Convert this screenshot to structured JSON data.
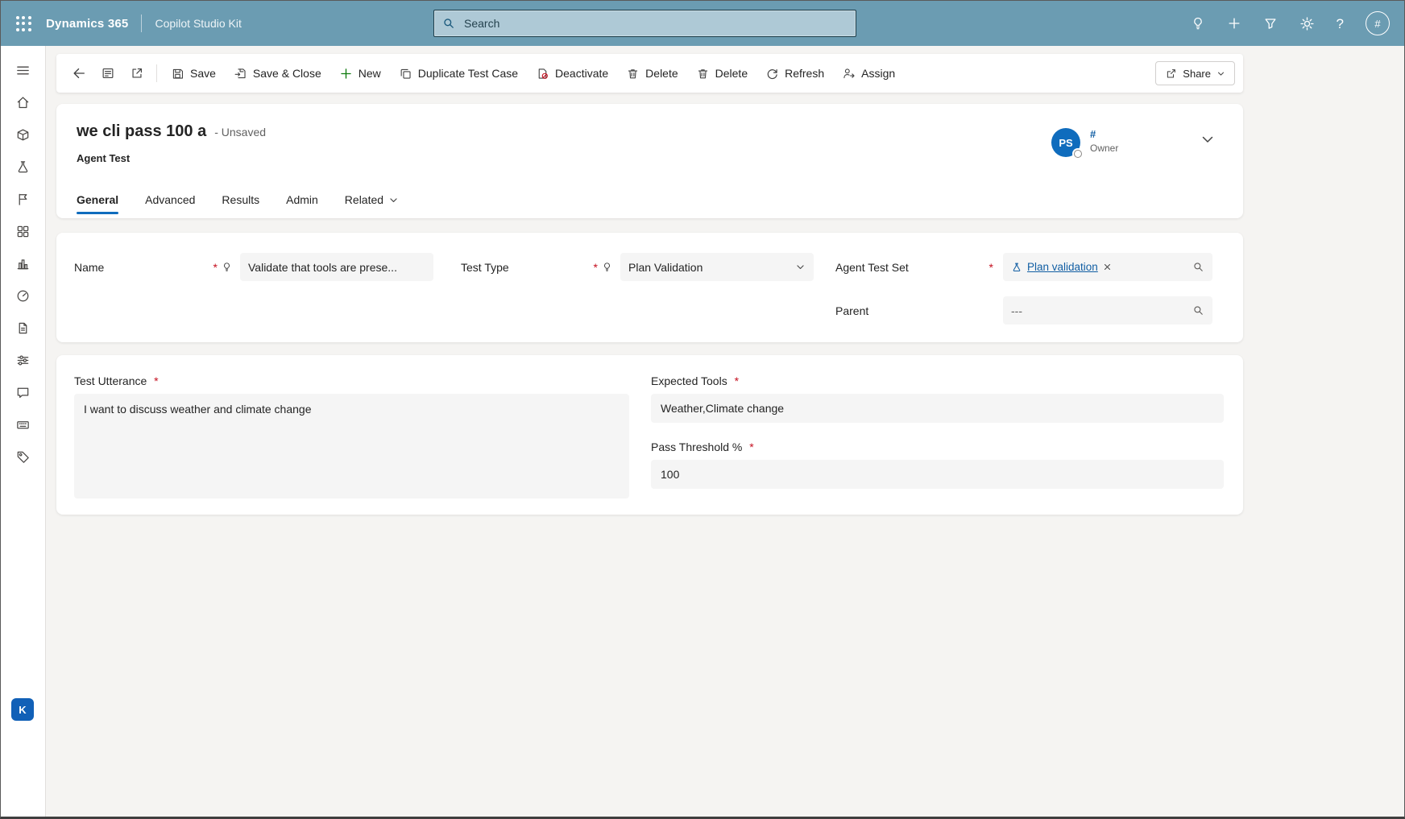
{
  "topbar": {
    "brand": "Dynamics 365",
    "app": "Copilot Studio Kit",
    "search_placeholder": "Search",
    "account_initial": "#",
    "icons": [
      "app-launcher",
      "lightbulb",
      "add",
      "filter",
      "settings-gear",
      "help",
      "account-avatar"
    ]
  },
  "command_bar": {
    "icons": [
      "back-arrow",
      "form-switcher",
      "popout",
      "save",
      "save-and-close",
      "plus",
      "duplicate",
      "deactivate",
      "trash",
      "trash",
      "refresh",
      "assign",
      "share"
    ],
    "items": [
      {
        "label": "Save"
      },
      {
        "label": "Save & Close"
      },
      {
        "label": "New"
      },
      {
        "label": "Duplicate Test Case"
      },
      {
        "label": "Deactivate"
      },
      {
        "label": "Delete"
      },
      {
        "label": "Delete"
      },
      {
        "label": "Refresh"
      },
      {
        "label": "Assign"
      }
    ],
    "share": "Share"
  },
  "record": {
    "title": "we cli pass 100 a",
    "status": "- Unsaved",
    "entity": "Agent Test",
    "owner": {
      "initials": "PS",
      "name": "#",
      "role": "Owner"
    },
    "tabs": [
      {
        "label": "General",
        "active": true
      },
      {
        "label": "Advanced"
      },
      {
        "label": "Results"
      },
      {
        "label": "Admin"
      },
      {
        "label": "Related",
        "has_menu": true
      }
    ]
  },
  "form": {
    "name": {
      "label": "Name",
      "required": true,
      "value": "Validate that tools are prese..."
    },
    "test_type": {
      "label": "Test Type",
      "required": true,
      "value": "Plan Validation"
    },
    "agent_test_set": {
      "label": "Agent Test Set",
      "required": true,
      "value": "Plan validation"
    },
    "parent": {
      "label": "Parent",
      "value": "---"
    },
    "test_utterance": {
      "label": "Test Utterance",
      "required": true,
      "value": "I want to discuss weather and climate change"
    },
    "expected_tools": {
      "label": "Expected Tools",
      "required": true,
      "value": "Weather,Climate change"
    },
    "pass_threshold": {
      "label": "Pass Threshold %",
      "required": true,
      "value": "100"
    }
  },
  "sidebar": {
    "user_initial": "K",
    "icons": [
      "menu",
      "home",
      "box",
      "test-flask",
      "flag",
      "apps-grid",
      "bar-chart",
      "gauge",
      "document",
      "sliders",
      "chat",
      "keyboard",
      "tag"
    ]
  },
  "ui": {
    "required_marker": "*"
  },
  "colors": {
    "topbar": "#6b9cb2",
    "accent": "#0f6cbd",
    "link": "#115ea3",
    "required": "#c50f1f",
    "new_green": "#107c10",
    "field_fill": "#f5f5f5",
    "avatar_blue": "#1160b7"
  }
}
